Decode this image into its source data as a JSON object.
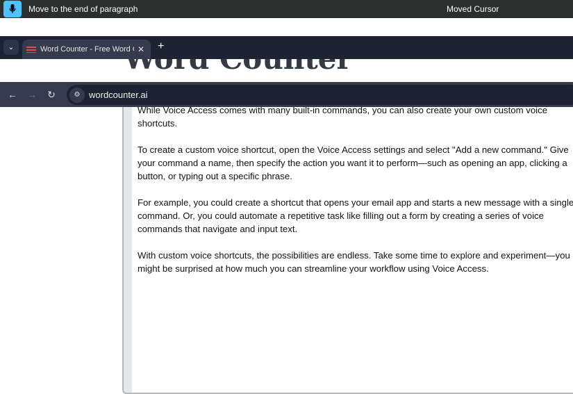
{
  "voice_access": {
    "command": "Move to the end of paragraph",
    "status": "Moved Cursor"
  },
  "browser": {
    "tab_title": "Word Counter - Free Word Counter",
    "url": "wordcounter.ai"
  },
  "page": {
    "title": "Word Counter",
    "paragraphs": [
      "While Voice Access comes with many built-in commands, you can also create your own custom voice shortcuts.",
      "To create a custom voice shortcut, open the Voice Access settings and select \"Add a new command.\" Give your command a name, then specify the action you want it to perform—such as opening an app, clicking a button, or typing out a specific phrase.",
      "For example, you could create a shortcut that opens your email app and starts a new message with a single command. Or, you could automate a repetitive task like filling out a form by creating a series of voice commands that navigate and input text.",
      "With custom voice shortcuts, the possibilities are endless. Take some time to explore and experiment—you might be surprised at how much you can streamline your workflow using Voice Access."
    ]
  }
}
